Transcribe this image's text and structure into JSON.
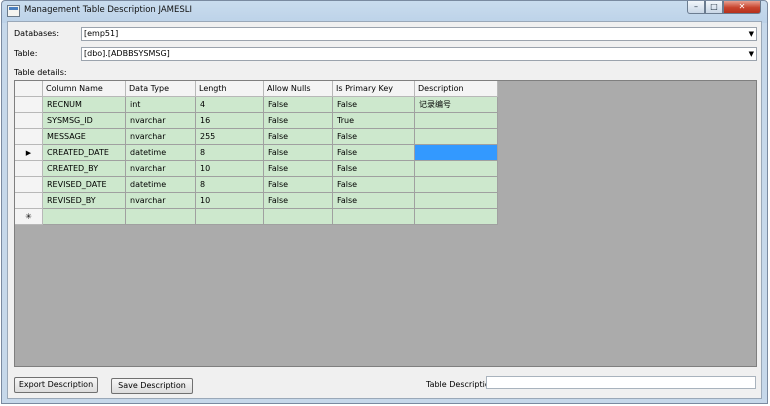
{
  "window": {
    "title": "Management Table Description JAMESLI",
    "minimize": "–",
    "maximize": "□",
    "close": "✕"
  },
  "form": {
    "databases_label": "Databases:",
    "databases_value": "[emp51]",
    "table_label": "Table:",
    "table_value": "[dbo].[ADBBSYSMSG]",
    "details_label": "Table details:"
  },
  "grid": {
    "columns": [
      "Column Name",
      "Data Type",
      "Length",
      "Allow Nulls",
      "Is Primary Key",
      "Description"
    ],
    "rows": [
      [
        "RECNUM",
        "int",
        "4",
        "False",
        "False",
        "记录编号"
      ],
      [
        "SYSMSG_ID",
        "nvarchar",
        "16",
        "False",
        "True",
        ""
      ],
      [
        "MESSAGE",
        "nvarchar",
        "255",
        "False",
        "False",
        ""
      ],
      [
        "CREATED_DATE",
        "datetime",
        "8",
        "False",
        "False",
        ""
      ],
      [
        "CREATED_BY",
        "nvarchar",
        "10",
        "False",
        "False",
        ""
      ],
      [
        "REVISED_DATE",
        "datetime",
        "8",
        "False",
        "False",
        ""
      ],
      [
        "REVISED_BY",
        "nvarchar",
        "10",
        "False",
        "False",
        ""
      ]
    ],
    "current_row_marker": "▶",
    "new_row_marker": "✳",
    "current_row_index": 3,
    "selected_cell_column": 5,
    "row_color": "#cde8cd",
    "selection_color": "#3399ff"
  },
  "footer": {
    "export_label": "Export Description",
    "save_label": "Save Description",
    "table_description_label": "Table Description:",
    "table_description_value": ""
  }
}
